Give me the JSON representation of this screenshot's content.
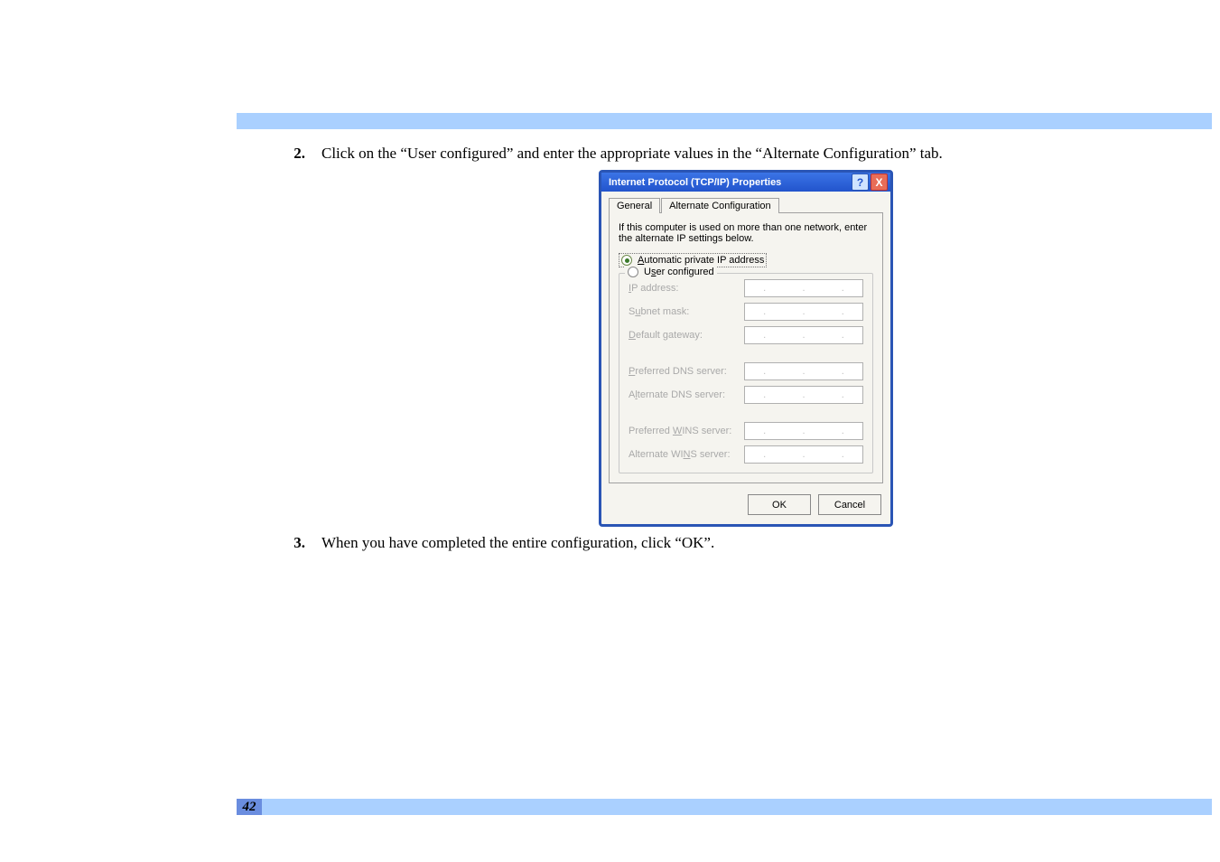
{
  "page_number": "42",
  "steps": {
    "s2": {
      "num": "2.",
      "text": "Click on the “User configured” and enter the appropriate values in the “Alternate Configuration” tab."
    },
    "s3": {
      "num": "3.",
      "text": "When you have completed the entire configuration, click “OK”."
    }
  },
  "dialog": {
    "title": "Internet Protocol (TCP/IP) Properties",
    "help_glyph": "?",
    "close_glyph": "X",
    "tabs": {
      "general": "General",
      "alternate": "Alternate Configuration"
    },
    "intro": "If this computer is used on more than one network, enter the alternate IP settings below.",
    "radios": {
      "automatic_suffix": "utomatic private IP address",
      "user_configured_suffix": "er configured"
    },
    "fields": {
      "ip_address_suffix": "P address:",
      "subnet_mask_suffix": "bnet mask:",
      "default_gateway_suffix": "efault gateway:",
      "preferred_dns_suffix": "referred DNS server:",
      "alternate_dns_suffix": "ternate DNS server:",
      "preferred_wins_pre": "Preferred ",
      "preferred_wins_suffix": "INS server:",
      "alternate_wins_pre": "Alternate WI",
      "alternate_wins_suffix": "S server:"
    },
    "buttons": {
      "ok": "OK",
      "cancel": "Cancel"
    }
  }
}
